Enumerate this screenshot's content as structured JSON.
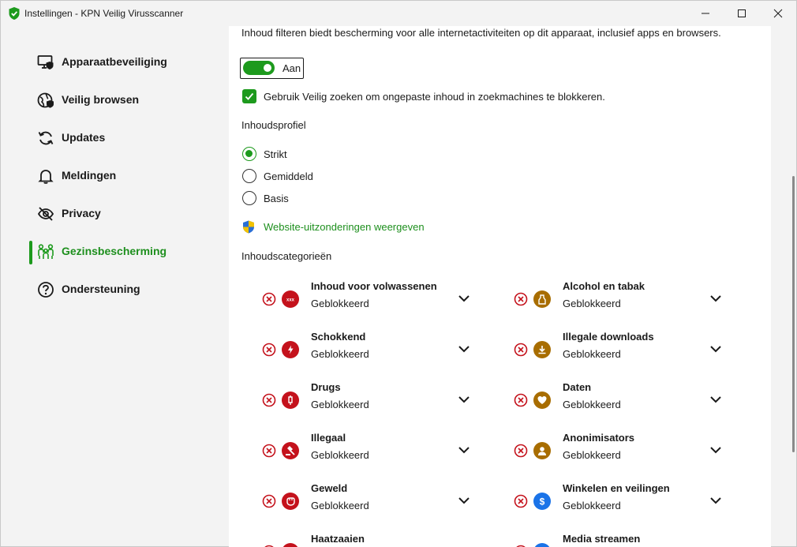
{
  "window": {
    "title": "Instellingen - KPN Veilig Virusscanner"
  },
  "colors": {
    "accent": "#1d9a1d",
    "danger": "#c4121c",
    "amber": "#a86d00",
    "blue": "#1a73e8"
  },
  "sidebar": {
    "items": [
      {
        "label": "Apparaatbeveiliging",
        "icon": "monitor-shield-icon"
      },
      {
        "label": "Veilig browsen",
        "icon": "globe-shield-icon"
      },
      {
        "label": "Updates",
        "icon": "refresh-icon"
      },
      {
        "label": "Meldingen",
        "icon": "bell-icon"
      },
      {
        "label": "Privacy",
        "icon": "eye-slash-icon"
      },
      {
        "label": "Gezinsbescherming",
        "icon": "family-icon",
        "active": true
      },
      {
        "label": "Ondersteuning",
        "icon": "question-icon"
      }
    ]
  },
  "main": {
    "description": "Inhoud filteren biedt bescherming voor alle internetactiviteiten op dit apparaat, inclusief apps en browsers.",
    "toggle_label": "Aan",
    "safe_search_label": "Gebruik Veilig zoeken om ongepaste inhoud in zoekmachines te blokkeren.",
    "profile_title": "Inhoudsprofiel",
    "profiles": [
      {
        "label": "Strikt",
        "checked": true
      },
      {
        "label": "Gemiddeld",
        "checked": false
      },
      {
        "label": "Basis",
        "checked": false
      }
    ],
    "exceptions_link": "Website-uitzonderingen weergeven",
    "categories_title": "Inhoudscategorieën",
    "categories": [
      {
        "name": "Inhoud voor volwassenen",
        "status": "Geblokkeerd",
        "icon": "xxx-icon",
        "color": "#c4121c"
      },
      {
        "name": "Alcohol en tabak",
        "status": "Geblokkeerd",
        "icon": "bottle-icon",
        "color": "#a86d00"
      },
      {
        "name": "Schokkend",
        "status": "Geblokkeerd",
        "icon": "lightning-icon",
        "color": "#c4121c"
      },
      {
        "name": "Illegale downloads",
        "status": "Geblokkeerd",
        "icon": "download-icon",
        "color": "#a86d00"
      },
      {
        "name": "Drugs",
        "status": "Geblokkeerd",
        "icon": "syringe-icon",
        "color": "#c4121c"
      },
      {
        "name": "Daten",
        "status": "Geblokkeerd",
        "icon": "heart-icon",
        "color": "#a86d00"
      },
      {
        "name": "Illegaal",
        "status": "Geblokkeerd",
        "icon": "gavel-icon",
        "color": "#c4121c"
      },
      {
        "name": "Anonimisators",
        "status": "Geblokkeerd",
        "icon": "incognito-icon",
        "color": "#a86d00"
      },
      {
        "name": "Geweld",
        "status": "Geblokkeerd",
        "icon": "fist-icon",
        "color": "#c4121c"
      },
      {
        "name": "Winkelen en veilingen",
        "status": "Geblokkeerd",
        "icon": "dollar-icon",
        "color": "#1a73e8"
      },
      {
        "name": "Haatzaaien",
        "status": "",
        "icon": "target-icon",
        "color": "#c4121c"
      },
      {
        "name": "Media streamen",
        "status": "",
        "icon": "play-icon",
        "color": "#1a73e8"
      }
    ]
  }
}
